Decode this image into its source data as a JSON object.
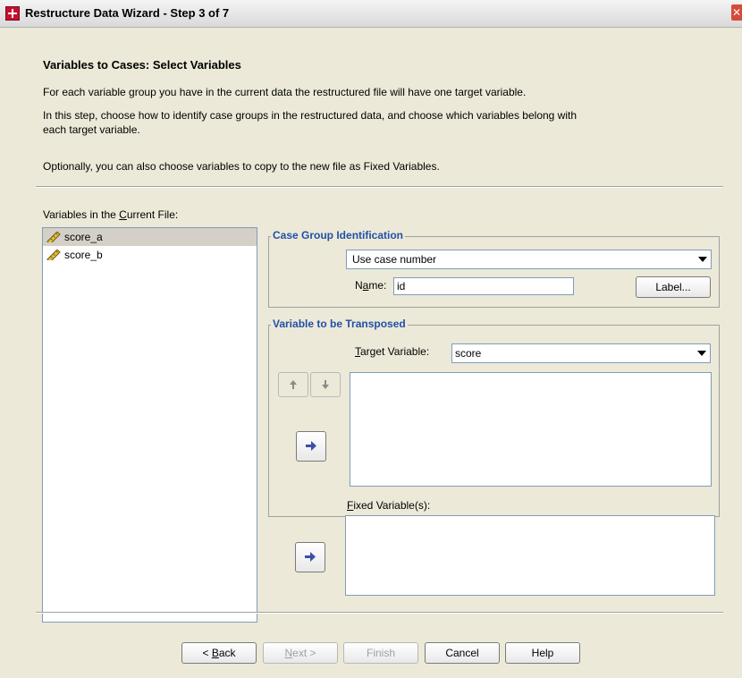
{
  "window": {
    "title": "Restructure Data Wizard - Step 3 of 7",
    "close_glyph": "✕"
  },
  "header": {
    "heading": "Variables to Cases: Select Variables",
    "para1": "For each variable group you have in the current data the restructured file will have one target variable.",
    "para2_line1": "In this step, choose how to identify case groups in the restructured data, and choose which variables belong with",
    "para2_line2": "each target variable.",
    "para3": "Optionally, you can also choose variables to copy to the new file as Fixed Variables."
  },
  "variables": {
    "label_pre": "Variables in the ",
    "label_ul": "C",
    "label_post": "urrent File:",
    "items": [
      {
        "name": "score_a",
        "icon": "scale-ruler-icon"
      },
      {
        "name": "score_b",
        "icon": "scale-ruler-icon"
      }
    ]
  },
  "case_group": {
    "title": "Case Group Identification",
    "method": "Use case number",
    "name_label_pre": "N",
    "name_label_ul": "a",
    "name_label_post": "me:",
    "name_value": "id",
    "label_button": "Label..."
  },
  "transpose": {
    "title": "Variable to be Transposed",
    "target_label_ul": "T",
    "target_label_post": "arget Variable:",
    "target_value": "score"
  },
  "fixed": {
    "label_ul": "F",
    "label_post": "ixed Variable(s):"
  },
  "footer": {
    "back_pre": "< ",
    "back_ul": "B",
    "back_post": "ack",
    "next_ul": "N",
    "next_post": "ext >",
    "finish": "Finish",
    "cancel": "Cancel",
    "help": "Help"
  },
  "colors": {
    "accent": "#2150a8",
    "selection": "#d4d0c8",
    "panel": "#ece9d8",
    "arrow": "#3a4fa8"
  }
}
